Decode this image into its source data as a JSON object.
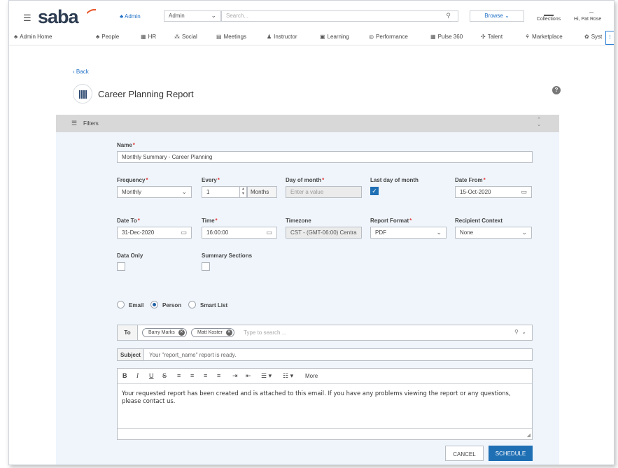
{
  "header": {
    "logo": "saba",
    "role_link": "Admin",
    "role_select": "Admin",
    "search_placeholder": "Search...",
    "browse": "Browse",
    "collections": "Collections",
    "user": "Hi, Pat Rose"
  },
  "menu": {
    "items": [
      {
        "label": "Admin Home",
        "icon": "admin-icon"
      },
      {
        "label": "People",
        "icon": "people-icon"
      },
      {
        "label": "HR",
        "icon": "hr-icon"
      },
      {
        "label": "Social",
        "icon": "social-icon"
      },
      {
        "label": "Meetings",
        "icon": "meetings-icon"
      },
      {
        "label": "Instructor",
        "icon": "instructor-icon"
      },
      {
        "label": "Learning",
        "icon": "learning-icon"
      },
      {
        "label": "Performance",
        "icon": "performance-icon"
      },
      {
        "label": "Pulse 360",
        "icon": "pulse-icon"
      },
      {
        "label": "Talent",
        "icon": "talent-icon"
      },
      {
        "label": "Marketplace",
        "icon": "marketplace-icon"
      },
      {
        "label": "Syst",
        "icon": "gear-icon"
      }
    ]
  },
  "page": {
    "back": "Back",
    "title": "Career Planning Report",
    "help": "?"
  },
  "filters": {
    "label": "Filters"
  },
  "form": {
    "name_label": "Name",
    "name_value": "Monthly Summary - Career Planning",
    "frequency_label": "Frequency",
    "frequency_value": "Monthly",
    "every_label": "Every",
    "every_value": "1",
    "every_unit": "Months",
    "day_of_month_label": "Day of month",
    "day_of_month_placeholder": "Enter a value",
    "last_day_label": "Last day of month",
    "last_day_checked": true,
    "date_from_label": "Date From",
    "date_from_value": "15-Oct-2020",
    "date_to_label": "Date To",
    "date_to_value": "31-Dec-2020",
    "time_label": "Time",
    "time_value": "16:00:00",
    "timezone_label": "Timezone",
    "timezone_value": "CST - (GMT-06:00) Centra",
    "report_format_label": "Report Format",
    "report_format_value": "PDF",
    "recipient_context_label": "Recipient Context",
    "recipient_context_value": "None",
    "data_only_label": "Data Only",
    "summary_sections_label": "Summary Sections"
  },
  "recipients": {
    "options": [
      "Email",
      "Person",
      "Smart List"
    ],
    "selected": "Person",
    "to_label": "To",
    "chips": [
      "Barry Marks",
      "Matt Koster"
    ],
    "to_placeholder": "Type to search ...",
    "subject_label": "Subject",
    "subject_value": "Your \"report_name\" report is ready.",
    "more": "More",
    "body": "Your requested report has been created and is attached to this email. If you have any problems viewing the report or any questions, please contact us."
  },
  "buttons": {
    "cancel": "CANCEL",
    "schedule": "SCHEDULE"
  },
  "colors": {
    "brand": "#2e3d52",
    "accent": "#1f6fb4",
    "required": "#e03c3c",
    "panel_bg": "#eff5fb"
  }
}
